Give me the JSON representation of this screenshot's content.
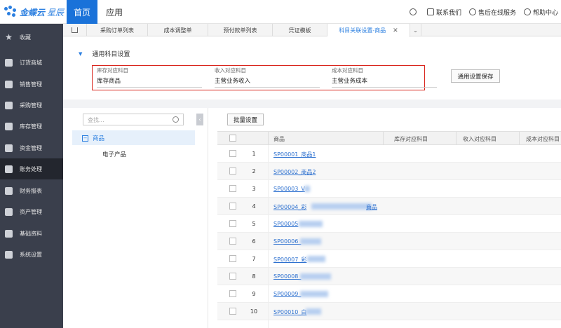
{
  "app": {
    "logo_text": "金蝶云",
    "logo_text2": "星辰",
    "nav_home": "首页",
    "nav_apps": "应用",
    "top_links": [
      "联系我们",
      "售后在线服务",
      "帮助中心"
    ]
  },
  "sidebar": {
    "items": [
      {
        "label": "收藏",
        "icon": "star-icon"
      },
      {
        "label": "订货商城",
        "icon": "mall-icon"
      },
      {
        "label": "销售管理",
        "icon": "chart-icon"
      },
      {
        "label": "采购管理",
        "icon": "cart-icon"
      },
      {
        "label": "库存管理",
        "icon": "box-icon"
      },
      {
        "label": "资金管理",
        "icon": "money-icon"
      },
      {
        "label": "账务处理",
        "icon": "yen-icon",
        "active": true
      },
      {
        "label": "财务报表",
        "icon": "report-icon"
      },
      {
        "label": "资产管理",
        "icon": "asset-icon"
      },
      {
        "label": "基础资料",
        "icon": "layers-icon"
      },
      {
        "label": "系统设置",
        "icon": "gear-icon"
      }
    ]
  },
  "tabs": [
    "采购订单列表",
    "成本调整单",
    "预付款单列表",
    "凭证模板",
    "科目关联设置-商品"
  ],
  "settings": {
    "title": "通用科目设置",
    "fields": [
      {
        "label": "库存对应科目",
        "value": "库存商品"
      },
      {
        "label": "收入对应科目",
        "value": "主营业务收入"
      },
      {
        "label": "成本对应科目",
        "value": "主营业务成本"
      }
    ],
    "save_button": "通用设置保存"
  },
  "tree": {
    "search_placeholder": "查找...",
    "root": "商品",
    "children": [
      "电子产品"
    ]
  },
  "grid": {
    "batch_button": "批量设置",
    "columns": [
      "商品",
      "库存对应科目",
      "收入对应科目",
      "成本对应科目"
    ],
    "rows": [
      {
        "num": "1",
        "code": "SP00001_商品1"
      },
      {
        "num": "2",
        "code": "SP00002_商品2"
      },
      {
        "num": "3",
        "code": "SP00003_V"
      },
      {
        "num": "4",
        "code": "SP00004_彩",
        "tail": "商品"
      },
      {
        "num": "5",
        "code": "SP00005"
      },
      {
        "num": "6",
        "code": "SP00006_"
      },
      {
        "num": "7",
        "code": "SP00007_彩"
      },
      {
        "num": "8",
        "code": "SP00008_"
      },
      {
        "num": "9",
        "code": "SP00009_"
      },
      {
        "num": "10",
        "code": "SP00010_白"
      }
    ]
  },
  "colors": {
    "accent": "#1a72d9",
    "sidebar": "#3a3f4c",
    "highlight": "#d9241c"
  }
}
